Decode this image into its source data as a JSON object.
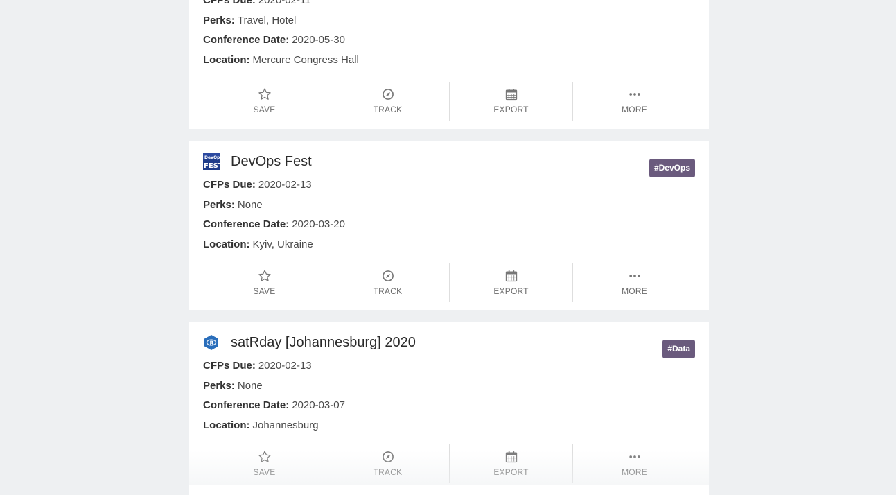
{
  "labels": {
    "cfps": "CFPs Due:",
    "perks": "Perks:",
    "date": "Conference Date:",
    "location": "Location:"
  },
  "actions": {
    "save": "SAVE",
    "track": "TRACK",
    "export": "EXPORT",
    "more": "MORE"
  },
  "icons": {
    "save": "star-icon",
    "track": "compass-icon",
    "export": "calendar-icon",
    "more": "more-dots-icon"
  },
  "colors": {
    "tag_bg": "#6a5a7d",
    "page_bg": "#eef0f2",
    "card_bg": "#ffffff"
  },
  "cards": [
    {
      "title": "",
      "tag": "",
      "cfps_due": "2020-02-11",
      "perks": "Travel, Hotel",
      "conference_date": "2020-05-30",
      "location": "Mercure Congress Hall"
    },
    {
      "title": "DevOps Fest",
      "tag": "#DevOps",
      "logo": "devops-fest-logo",
      "cfps_due": "2020-02-13",
      "perks": "None",
      "conference_date": "2020-03-20",
      "location": "Kyiv, Ukraine"
    },
    {
      "title": "satRday [Johannesburg] 2020",
      "tag": "#Data",
      "logo": "r-hexagon-logo",
      "cfps_due": "2020-02-13",
      "perks": "None",
      "conference_date": "2020-03-07",
      "location": "Johannesburg"
    }
  ]
}
